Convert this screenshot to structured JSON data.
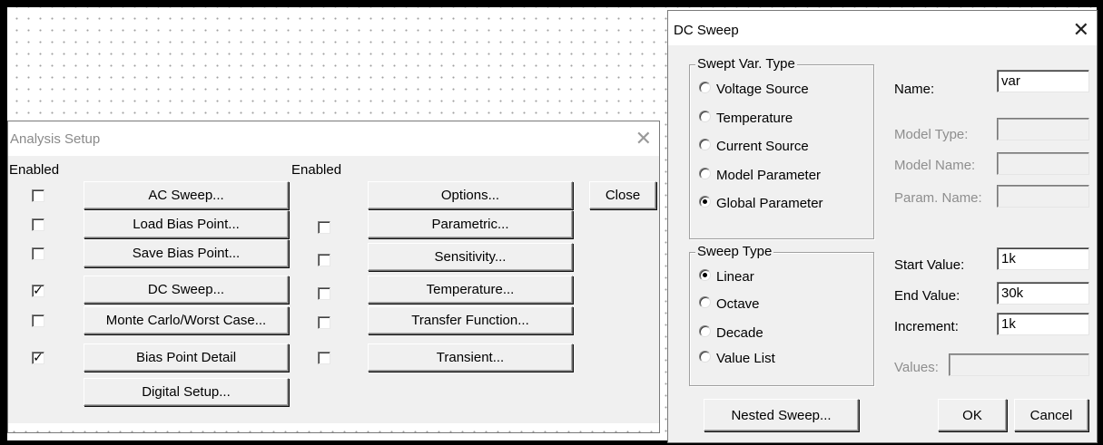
{
  "analysis_setup": {
    "title": "Analysis Setup",
    "enabled_header_left": "Enabled",
    "enabled_header_right": "Enabled",
    "close_label": "Close",
    "left_buttons": [
      {
        "label": "AC Sweep...",
        "checked": false
      },
      {
        "label": "Load Bias Point...",
        "checked": false
      },
      {
        "label": "Save Bias Point...",
        "checked": false
      },
      {
        "label": "DC Sweep...",
        "checked": true
      },
      {
        "label": "Monte Carlo/Worst Case...",
        "checked": false
      },
      {
        "label": "Bias Point Detail",
        "checked": true
      },
      {
        "label": "Digital Setup..."
      }
    ],
    "right_buttons": [
      {
        "label": "Options..."
      },
      {
        "label": "Parametric...",
        "checked": false
      },
      {
        "label": "Sensitivity...",
        "checked": false
      },
      {
        "label": "Temperature...",
        "checked": false
      },
      {
        "label": "Transfer Function...",
        "checked": false
      },
      {
        "label": "Transient...",
        "checked": false
      }
    ]
  },
  "dc_sweep": {
    "title": "DC Sweep",
    "swept_var_type": {
      "legend": "Swept Var. Type",
      "options": [
        "Voltage Source",
        "Temperature",
        "Current Source",
        "Model Parameter",
        "Global Parameter"
      ],
      "selected": "Global Parameter"
    },
    "sweep_type": {
      "legend": "Sweep Type",
      "options": [
        "Linear",
        "Octave",
        "Decade",
        "Value List"
      ],
      "selected": "Linear"
    },
    "fields": {
      "name_label": "Name:",
      "name_value": "var",
      "model_type_label": "Model Type:",
      "model_name_label": "Model Name:",
      "param_name_label": "Param. Name:",
      "start_label": "Start Value:",
      "start_value": "1k",
      "end_label": "End Value:",
      "end_value": "30k",
      "increment_label": "Increment:",
      "increment_value": "1k",
      "values_label": "Values:"
    },
    "nested_sweep_label": "Nested Sweep...",
    "ok_label": "OK",
    "cancel_label": "Cancel"
  }
}
